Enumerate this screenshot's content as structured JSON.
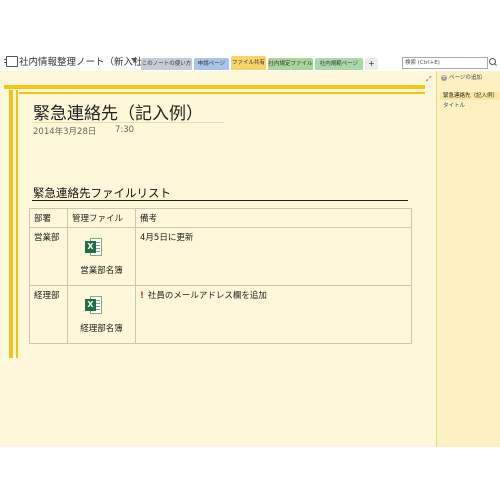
{
  "header": {
    "notebook_title": "社内情報整理ノート（新入社…",
    "tabs": [
      "このノートの使い方",
      "申請ページ",
      "ファイル共有",
      "社内規定ファイル",
      "社内規範ページ",
      "+"
    ],
    "search_placeholder": "検索 (Ctrl+E)"
  },
  "page": {
    "title": "緊急連絡先（記入例）",
    "date": "2014年3月28日",
    "time": "7:30",
    "section_title": "緊急連絡先ファイルリスト",
    "table": {
      "headers": [
        "部署",
        "管理ファイル",
        "備考"
      ],
      "rows": [
        {
          "dept": "営業部",
          "file": "営業部名簿",
          "note_mark": "",
          "note": "4月5日に更新"
        },
        {
          "dept": "経理部",
          "file": "経理部名簿",
          "note_mark": "!",
          "note": "社員のメールアドレス欄を追加"
        }
      ]
    }
  },
  "page_pane": {
    "add_page": "ページの追加",
    "pages": [
      "緊急連絡先（記入例）",
      "タイトル"
    ]
  },
  "colors": {
    "accent_yellow": "#f4c514",
    "excel_green": "#1e7145",
    "page_bg": "#fff7d9"
  },
  "icons": {
    "file_icon": "excel-file-icon"
  }
}
